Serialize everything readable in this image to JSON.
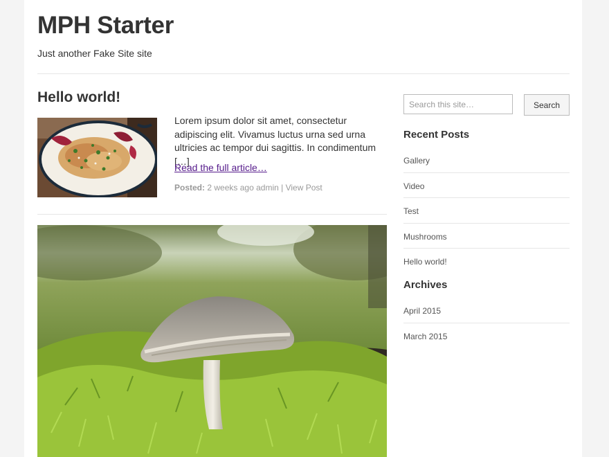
{
  "site": {
    "title": "MPH Starter",
    "description": "Just another Fake Site site"
  },
  "post": {
    "title": "Hello world!",
    "excerpt": "Lorem ipsum dolor sit amet, consectetur adipiscing elit. Vivamus luctus urna sed urna ultricies ac tempor dui sagittis. In condimentum […]",
    "read_more": "Read the full article…",
    "meta_label": "Posted:",
    "meta_time": "2 weeks ago",
    "meta_author": "admin",
    "meta_separator": "|",
    "meta_view": "View Post"
  },
  "sidebar": {
    "search_placeholder": "Search this site…",
    "search_button": "Search",
    "recent_title": "Recent Posts",
    "recent_posts": [
      "Gallery",
      "Video",
      "Test",
      "Mushrooms",
      "Hello world!"
    ],
    "archives_title": "Archives",
    "archives": [
      "April 2015",
      "March 2015"
    ]
  },
  "colors": {
    "page_bg": "#f4f4f4",
    "content_bg": "#ffffff",
    "text": "#333333",
    "visited_link": "#551a8b",
    "muted": "#999999"
  }
}
